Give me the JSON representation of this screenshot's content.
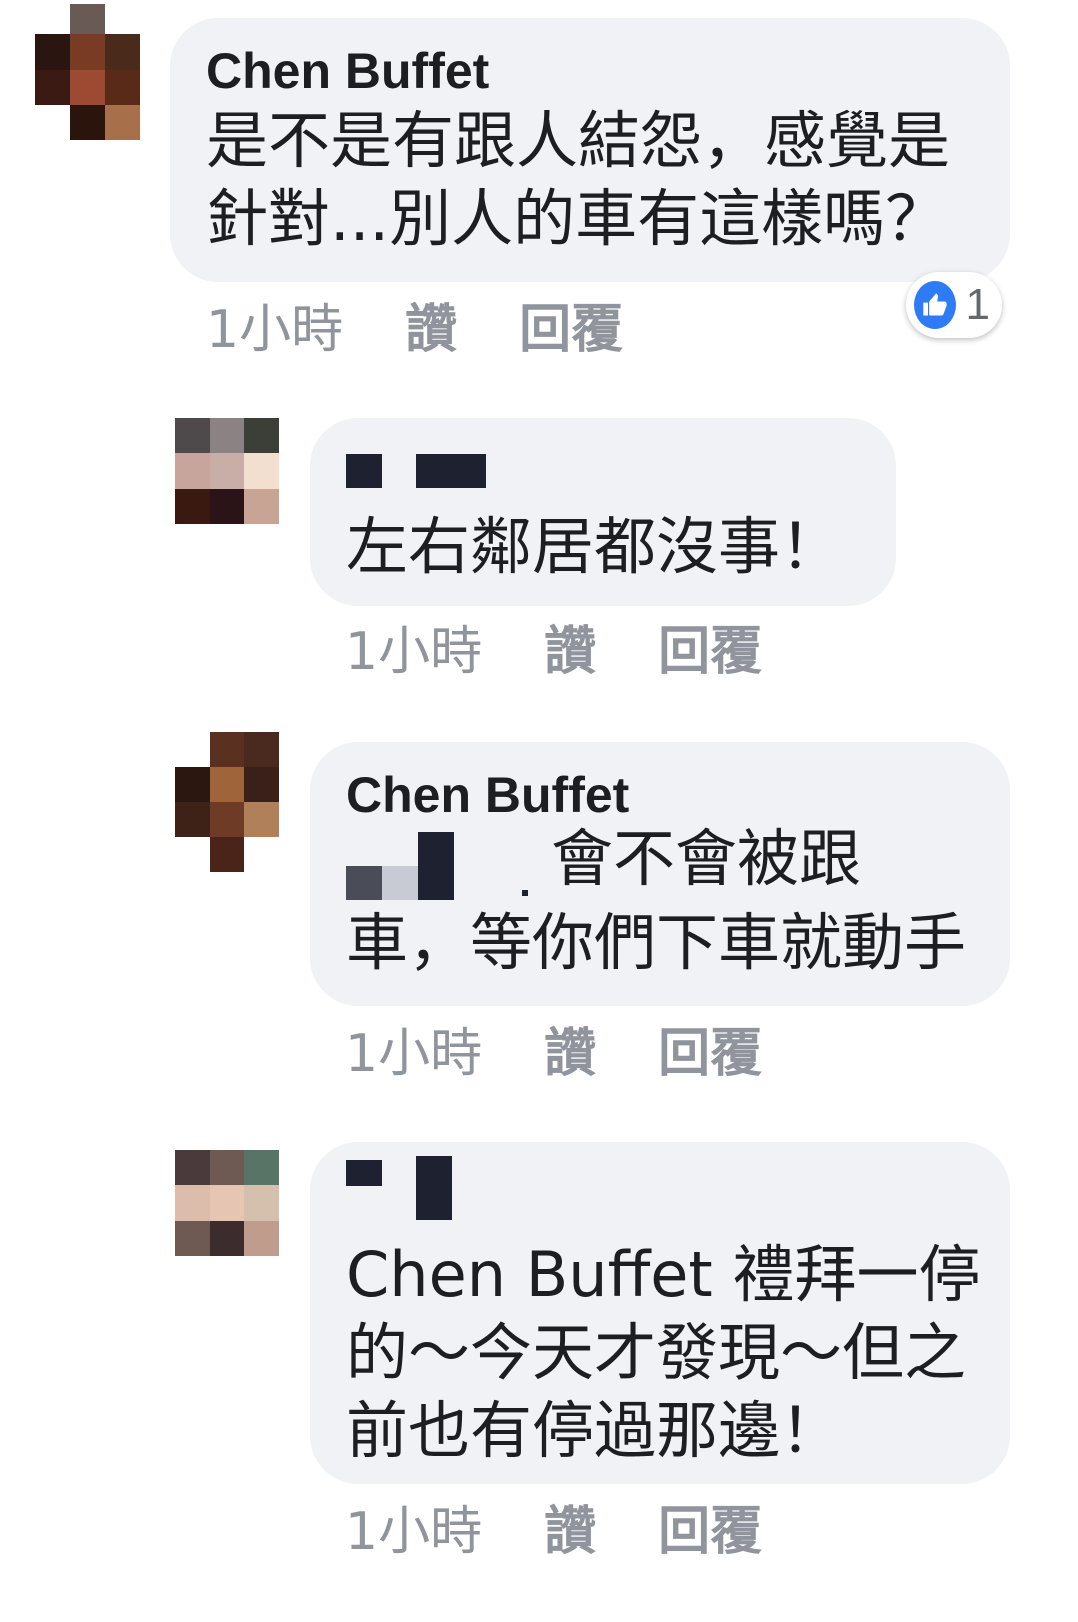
{
  "comments": [
    {
      "author": "Chen Buffet",
      "lines": [
        "是不是有跟人結怨，感覺是",
        "針對...別人的車有這樣嗎？"
      ],
      "time": "1小時",
      "like": "讚",
      "reply": "回覆",
      "reaction_count": "1"
    },
    {
      "author": "",
      "lines": [
        "左右鄰居都沒事！"
      ],
      "time": "1小時",
      "like": "讚",
      "reply": "回覆"
    },
    {
      "author": "Chen Buffet",
      "lines": [
        "會不會被跟",
        "車，等你們下車就動手"
      ],
      "time": "1小時",
      "like": "讚",
      "reply": "回覆"
    },
    {
      "author": "",
      "lines": [
        "Chen Buffet 禮拜一停",
        "的～今天才發現～但之",
        "前也有停過那邊！"
      ],
      "time": "1小時",
      "like": "讚",
      "reply": "回覆"
    }
  ],
  "reaction_icon": "thumbs-up-icon",
  "colors": {
    "bubble": "#f0f2f5",
    "meta_text": "#90949c",
    "like_blue": "#2e7bf6"
  }
}
